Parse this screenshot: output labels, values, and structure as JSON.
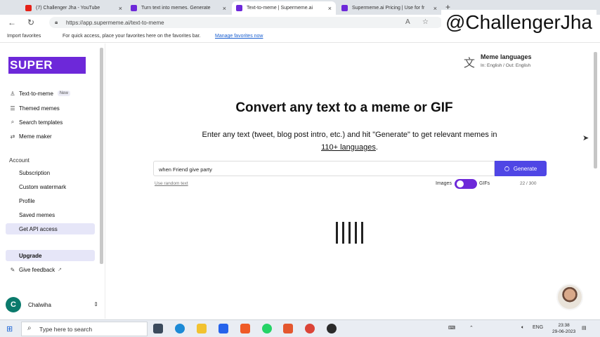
{
  "browser": {
    "tabs": [
      {
        "label": "(7) Challenger Jha - YouTube",
        "favicon_color": "#e62117"
      },
      {
        "label": "Turn text into memes. Generate",
        "favicon_color": "#6d28d9"
      },
      {
        "label": "Text-to-meme | Supermeme.ai",
        "favicon_color": "#6d28d9"
      },
      {
        "label": "Supermeme.ai Pricing | Use for fr",
        "favicon_color": "#6d28d9"
      }
    ],
    "new_tab": "+",
    "url": "https://app.supermeme.ai/text-to-meme",
    "favorites": {
      "import_label": "Import favorites",
      "message": "For quick access, place your favorites here on the favorites bar.",
      "manage_link": "Manage favorites now"
    }
  },
  "watermark": "@ChallengerJha",
  "sidebar": {
    "logo": "SUPER MEME",
    "items": [
      {
        "label": "Text-to-meme",
        "badge": "New",
        "icon": "user-icon"
      },
      {
        "label": "Themed memes",
        "icon": "list-icon"
      },
      {
        "label": "Search templates",
        "icon": "search-icon"
      },
      {
        "label": "Meme maker",
        "icon": "shuffle-icon"
      }
    ],
    "account_label": "Account",
    "account_items": [
      {
        "label": "Subscription"
      },
      {
        "label": "Custom watermark"
      },
      {
        "label": "Profile"
      },
      {
        "label": "Saved memes"
      },
      {
        "label": "Get API access"
      }
    ],
    "upgrade": "Upgrade",
    "feedback": "Give feedback",
    "workspace": {
      "initial": "C",
      "name": "Chalwiha"
    }
  },
  "main": {
    "languages": {
      "title": "Meme languages",
      "subtitle": "In: English / Out: English"
    },
    "headline": "Convert any text to a meme or GIF",
    "subline_part1": "Enter any text (tweet, blog post intro, etc.) and hit \"Generate\" to get relevant memes in",
    "subline_link": "110+ languages",
    "subline_end": ".",
    "input_value": "when Friend give party",
    "generate_label": "Generate",
    "random_text": "Use random text",
    "toggle_left": "Images",
    "toggle_right": "GIFs",
    "char_count": "22 / 300"
  },
  "taskbar": {
    "search_placeholder": "Type here to search",
    "lang": "ENG",
    "time": "23:38",
    "date": "29-06-2023"
  },
  "colors": {
    "brand_purple": "#6d28d9",
    "generate_blue": "#4f46e5",
    "selected_item_bg": "#e6e6f8"
  }
}
